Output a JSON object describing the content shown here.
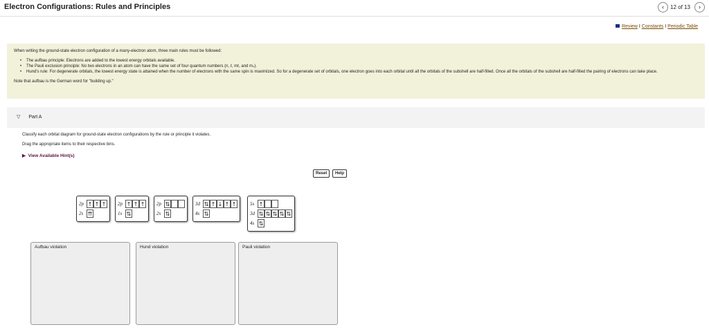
{
  "header": {
    "title": "Electron Configurations: Rules and Principles",
    "counter": "12 of 13",
    "prev": "‹",
    "next": "›"
  },
  "links": {
    "review": "Review",
    "constants": "Constants",
    "periodic": "Periodic Table",
    "sep": "I"
  },
  "intro": {
    "lead": "When writing the ground-state electron configuration of a many-electron atom, three main rules must be followed:",
    "rules": [
      "The aufbau principle: Electrons are added to the lowest energy orbitals available.",
      "The Pauli exclusion principle:  No two electrons in an atom can have the same set of four quantum numbers (n, ℓ, mℓ, and mₛ).",
      "Hund's rule: For degenerate orbitals, the lowest energy state is attained when the number of electrons with the same spin is maximized. So for a degenerate set of orbitals, one electron goes into each orbital until all the orbitals of the subshell are half-filled. Once all the orbitals of the subshell are half-filled the pairing of electrons can take place."
    ],
    "note": "Note that aufbau is the German word for \"building up.\""
  },
  "part": {
    "toggle": "▽",
    "label": "Part A",
    "instruction": "Classify each orbital diagram for ground-state electron configurations by the rule or principle it violates.",
    "drag": "Drag the appropriate items to their respective bins.",
    "hint": "View Available Hint(s)",
    "hint_icon": "▶",
    "reset": "Reset",
    "help": "Help"
  },
  "items": [
    {
      "rows": [
        {
          "label": "2p",
          "boxes": [
            "u",
            "u",
            "u"
          ]
        },
        {
          "label": "2s",
          "boxes": [
            "uu"
          ]
        }
      ]
    },
    {
      "rows": [
        {
          "label": "2p",
          "boxes": [
            "u",
            "u",
            "u"
          ]
        },
        {
          "label": "1s",
          "boxes": [
            "ud"
          ]
        }
      ]
    },
    {
      "rows": [
        {
          "label": "2p",
          "boxes": [
            "ud",
            "",
            ""
          ]
        },
        {
          "label": "2s",
          "boxes": [
            "ud"
          ]
        }
      ]
    },
    {
      "rows": [
        {
          "label": "3d",
          "boxes": [
            "ud",
            "u",
            "d",
            "u",
            "u"
          ]
        },
        {
          "label": "4s",
          "boxes": [
            "ud"
          ]
        }
      ]
    },
    {
      "rows": [
        {
          "label": "5s",
          "boxes": [
            "u",
            "",
            ""
          ]
        },
        {
          "label": "3d",
          "boxes": [
            "ud",
            "ud",
            "ud",
            "ud",
            "ud"
          ]
        },
        {
          "label": "4s",
          "boxes": [
            "ud"
          ]
        }
      ]
    }
  ],
  "bins": [
    "Aufbau violation",
    "Hund violation",
    "Pauli violation"
  ]
}
